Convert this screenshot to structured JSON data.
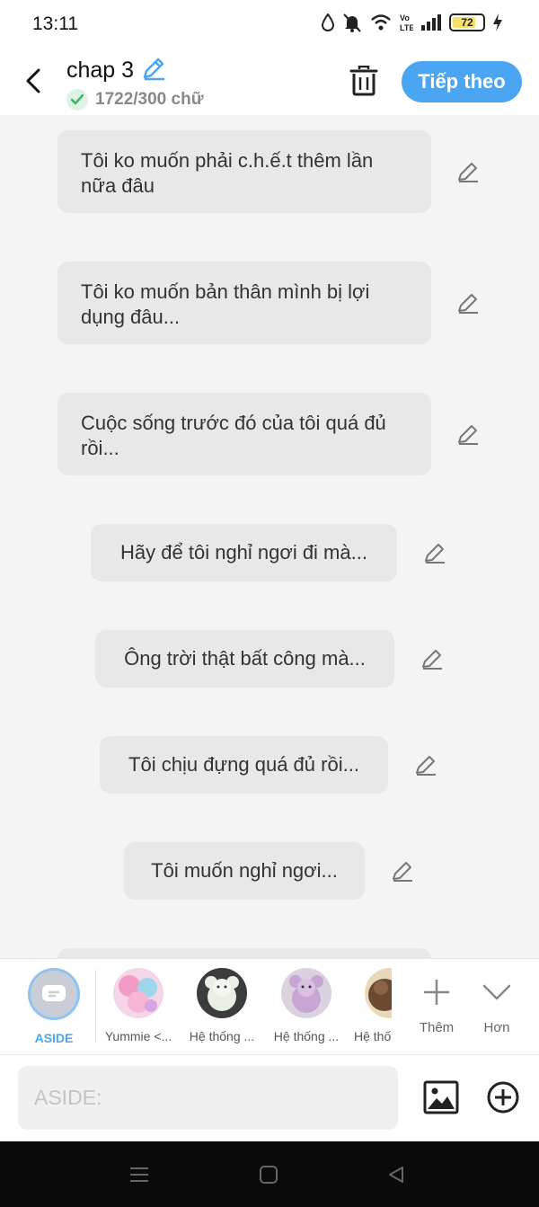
{
  "status_bar": {
    "time": "13:11",
    "battery": "72",
    "icons": [
      "water-drop-icon",
      "mute-icon",
      "wifi-icon",
      "volte-icon",
      "signal-icon",
      "battery-icon",
      "charging-icon"
    ]
  },
  "header": {
    "title": "chap 3",
    "word_count": "1722/300 chữ",
    "next_label": "Tiếp theo"
  },
  "messages": [
    {
      "text": "Tôi ko muốn phải c.h.ế.t thêm lần nữa đâu"
    },
    {
      "text": "Tôi ko muốn bản thân mình bị lợi dụng đâu..."
    },
    {
      "text": "Cuộc sống trước đó của tôi quá đủ rồi..."
    },
    {
      "text": "Hãy để tôi nghỉ ngơi đi mà..."
    },
    {
      "text": "Ông trời thật bất công mà..."
    },
    {
      "text": "Tôi chịu đựng quá đủ rồi..."
    },
    {
      "text": "Tôi muốn nghỉ ngơi..."
    }
  ],
  "characters": [
    {
      "label": "ASIDE",
      "selected": true
    },
    {
      "label": "Yummie <..."
    },
    {
      "label": "Hệ thống ..."
    },
    {
      "label": "Hệ thống ..."
    },
    {
      "label": "Hệ thố"
    }
  ],
  "bar_actions": {
    "more_label": "Thêm",
    "less_label": "Hơn"
  },
  "input": {
    "placeholder": "ASIDE:"
  },
  "colors": {
    "accent": "#4aa6f2",
    "bubble": "#e8e8e8",
    "background": "#f4f4f4"
  }
}
